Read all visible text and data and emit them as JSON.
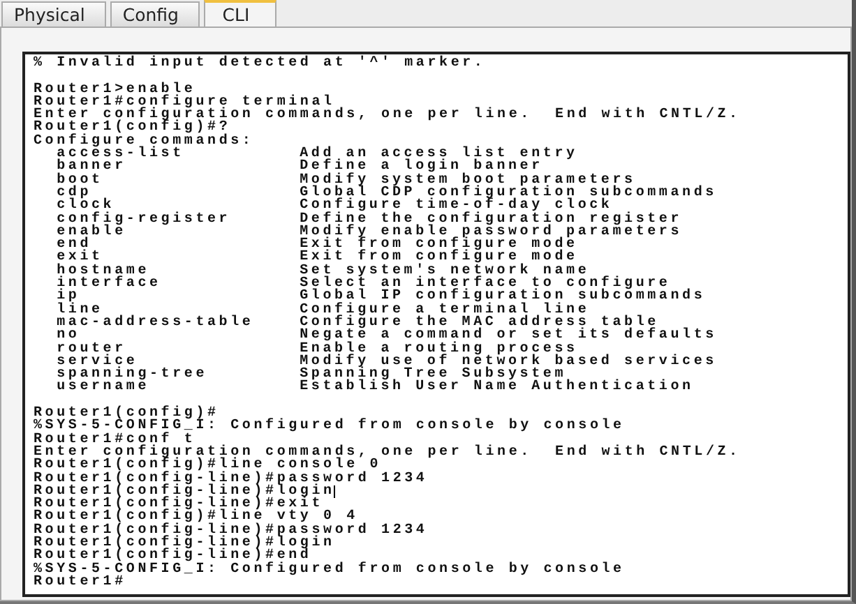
{
  "tabs": [
    {
      "label": "Physical",
      "selected": false
    },
    {
      "label": "Config",
      "selected": false
    },
    {
      "label": "CLI",
      "selected": true
    }
  ],
  "terminal": {
    "blocks": [
      {
        "lines": [
          {
            "text": "% Invalid input detected at '^' marker.",
            "cursor": false
          }
        ]
      },
      {
        "lines": [
          {
            "text": "Router1>enable",
            "cursor": false
          },
          {
            "text": "Router1#configure terminal",
            "cursor": false
          },
          {
            "text": "Enter configuration commands, one per line.  End with CNTL/Z.",
            "cursor": false
          },
          {
            "text": "Router1(config)#?",
            "cursor": false
          },
          {
            "text": "Configure commands:",
            "cursor": false
          }
        ],
        "commands": [
          {
            "name": "access-list",
            "description": "Add an access list entry"
          },
          {
            "name": "banner",
            "description": "Define a login banner"
          },
          {
            "name": "boot",
            "description": "Modify system boot parameters"
          },
          {
            "name": "cdp",
            "description": "Global CDP configuration subcommands"
          },
          {
            "name": "clock",
            "description": "Configure time-of-day clock"
          },
          {
            "name": "config-register",
            "description": "Define the configuration register"
          },
          {
            "name": "enable",
            "description": "Modify enable password parameters"
          },
          {
            "name": "end",
            "description": "Exit from configure mode"
          },
          {
            "name": "exit",
            "description": "Exit from configure mode"
          },
          {
            "name": "hostname",
            "description": "Set system's network name"
          },
          {
            "name": "interface",
            "description": "Select an interface to configure"
          },
          {
            "name": "ip",
            "description": "Global IP configuration subcommands"
          },
          {
            "name": "line",
            "description": "Configure a terminal line"
          },
          {
            "name": "mac-address-table",
            "description": "Configure the MAC address table"
          },
          {
            "name": "no",
            "description": "Negate a command or set its defaults"
          },
          {
            "name": "router",
            "description": "Enable a routing process"
          },
          {
            "name": "service",
            "description": "Modify use of network based services"
          },
          {
            "name": "spanning-tree",
            "description": "Spanning Tree Subsystem"
          },
          {
            "name": "username",
            "description": "Establish User Name Authentication"
          }
        ]
      },
      {
        "lines": [
          {
            "text": "Router1(config)#",
            "cursor": false
          },
          {
            "text": "%SYS-5-CONFIG_I: Configured from console by console",
            "cursor": false
          },
          {
            "text": "Router1#conf t",
            "cursor": false
          },
          {
            "text": "Enter configuration commands, one per line.  End with CNTL/Z.",
            "cursor": false
          },
          {
            "text": "Router1(config)#line console 0",
            "cursor": false
          },
          {
            "text": "Router1(config-line)#password 1234",
            "cursor": false
          },
          {
            "text": "Router1(config-line)#login",
            "cursor": true
          },
          {
            "text": "Router1(config-line)#exit",
            "cursor": false
          },
          {
            "text": "Router1(config)#line vty 0 4",
            "cursor": false
          },
          {
            "text": "Router1(config-line)#password 1234",
            "cursor": false
          },
          {
            "text": "Router1(config-line)#login",
            "cursor": false
          },
          {
            "text": "Router1(config-line)#end",
            "cursor": false
          },
          {
            "text": "%SYS-5-CONFIG_I: Configured from console by console",
            "cursor": false
          },
          {
            "text": "Router1#",
            "cursor": false
          }
        ]
      }
    ]
  }
}
